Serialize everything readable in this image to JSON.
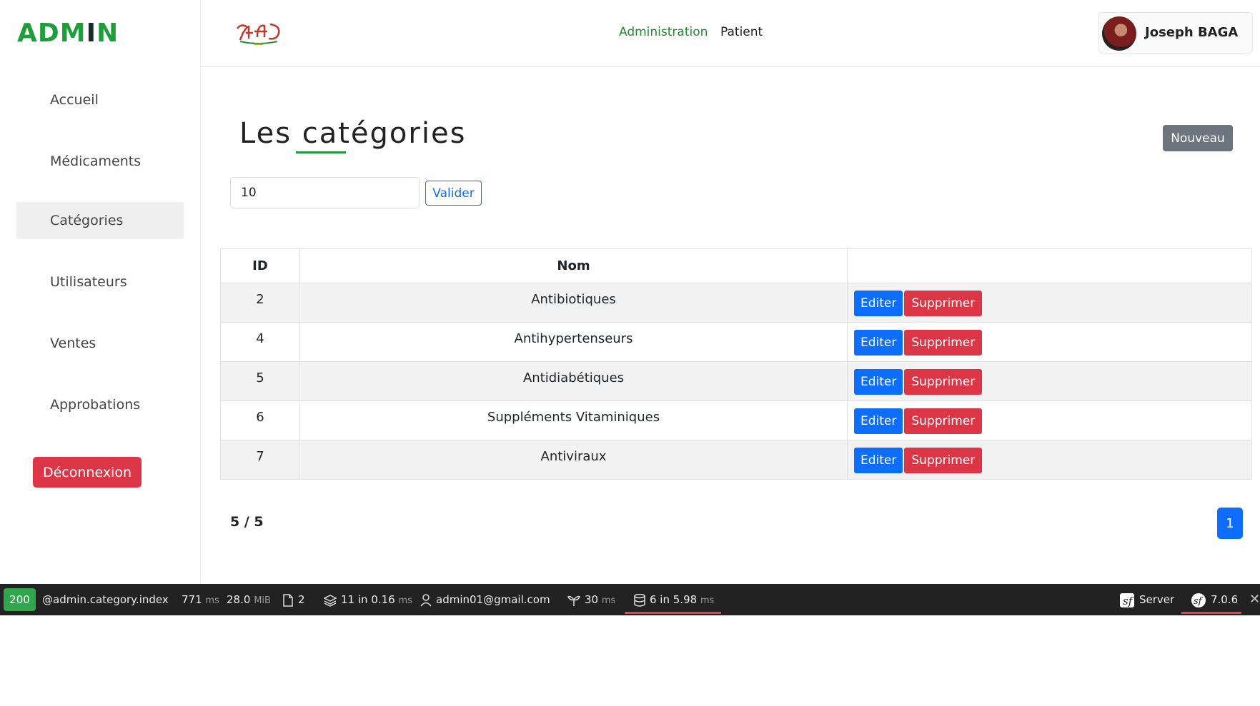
{
  "sidebar": {
    "brand_part1": "ADM",
    "brand_part2": "I",
    "brand_part3": "N",
    "items": [
      {
        "label": "Accueil"
      },
      {
        "label": "Médicaments"
      },
      {
        "label": "Catégories"
      },
      {
        "label": "Utilisateurs"
      },
      {
        "label": "Ventes"
      },
      {
        "label": "Approbations"
      }
    ],
    "logout_label": "Déconnexion"
  },
  "header": {
    "nav_admin": "Administration",
    "nav_patient": "Patient",
    "user_name": "Joseph BAGA"
  },
  "main": {
    "title": "Les catégories",
    "new_label": "Nouveau",
    "per_page_value": "10",
    "validate_label": "Valider",
    "columns": [
      "ID",
      "Nom",
      ""
    ],
    "rows": [
      {
        "id": "2",
        "nom": "Antibiotiques"
      },
      {
        "id": "4",
        "nom": "Antihypertenseurs"
      },
      {
        "id": "5",
        "nom": "Antidiabétiques"
      },
      {
        "id": "6",
        "nom": "Suppléments Vitaminiques"
      },
      {
        "id": "7",
        "nom": "Antiviraux"
      }
    ],
    "edit_label": "Editer",
    "delete_label": "Supprimer",
    "count_label": "5 / 5",
    "current_page": "1"
  },
  "toolbar": {
    "status_code": "200",
    "route": "@admin.category.index",
    "time_value": "771",
    "time_unit": "ms",
    "memory_value": "28.0",
    "memory_unit": "MiB",
    "files": "2",
    "cache_value": "11 in 0.16",
    "cache_unit": "ms",
    "user": "admin01@gmail.com",
    "twig_value": "30",
    "twig_unit": "ms",
    "db_value": "6 in 5.98",
    "db_unit": "ms",
    "server_label": "Server",
    "version": "7.0.6"
  },
  "colors": {
    "accent_green": "#1f9d3a",
    "primary_blue": "#0d6efd",
    "danger_red": "#dc3545",
    "secondary_gray": "#6c757d"
  }
}
